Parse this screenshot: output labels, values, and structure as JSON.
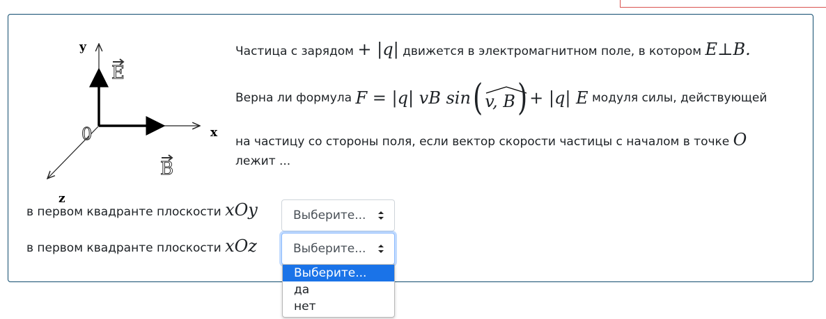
{
  "question": {
    "intro_prefix": "Частица с зарядом",
    "intro_charge": "+ |q|",
    "intro_middle": "движется в электромагнитном поле, в котором",
    "intro_condition": "E⊥B.",
    "formula_prefix": "Верна ли формула",
    "formula_lhs": "F = |q| vB sin",
    "formula_angle": "v, B",
    "formula_rhs": "+ |q| E",
    "formula_suffix": "модуля силы, действующей",
    "line3_text": "на частицу со стороны поля, если вектор скорости частицы с началом в точке",
    "line3_point": "O",
    "line4_text": "лежит ..."
  },
  "diagram": {
    "axis_y": "y",
    "axis_x": "x",
    "axis_z": "z",
    "origin": "0",
    "vec_e": "E",
    "vec_b": "B"
  },
  "subquestions": [
    {
      "text": "в первом квадранте плоскости",
      "plane": "xOy",
      "selected": "Выберите..."
    },
    {
      "text": "в первом квадранте плоскости",
      "plane": "xOz",
      "selected": "Выберите..."
    }
  ],
  "dropdown": {
    "options": [
      "Выберите...",
      "да",
      "нет"
    ],
    "highlighted_index": 0
  },
  "colors": {
    "box_border": "#0f4b6e",
    "highlight": "#1a73e8",
    "focus_border": "#8bbafe"
  }
}
